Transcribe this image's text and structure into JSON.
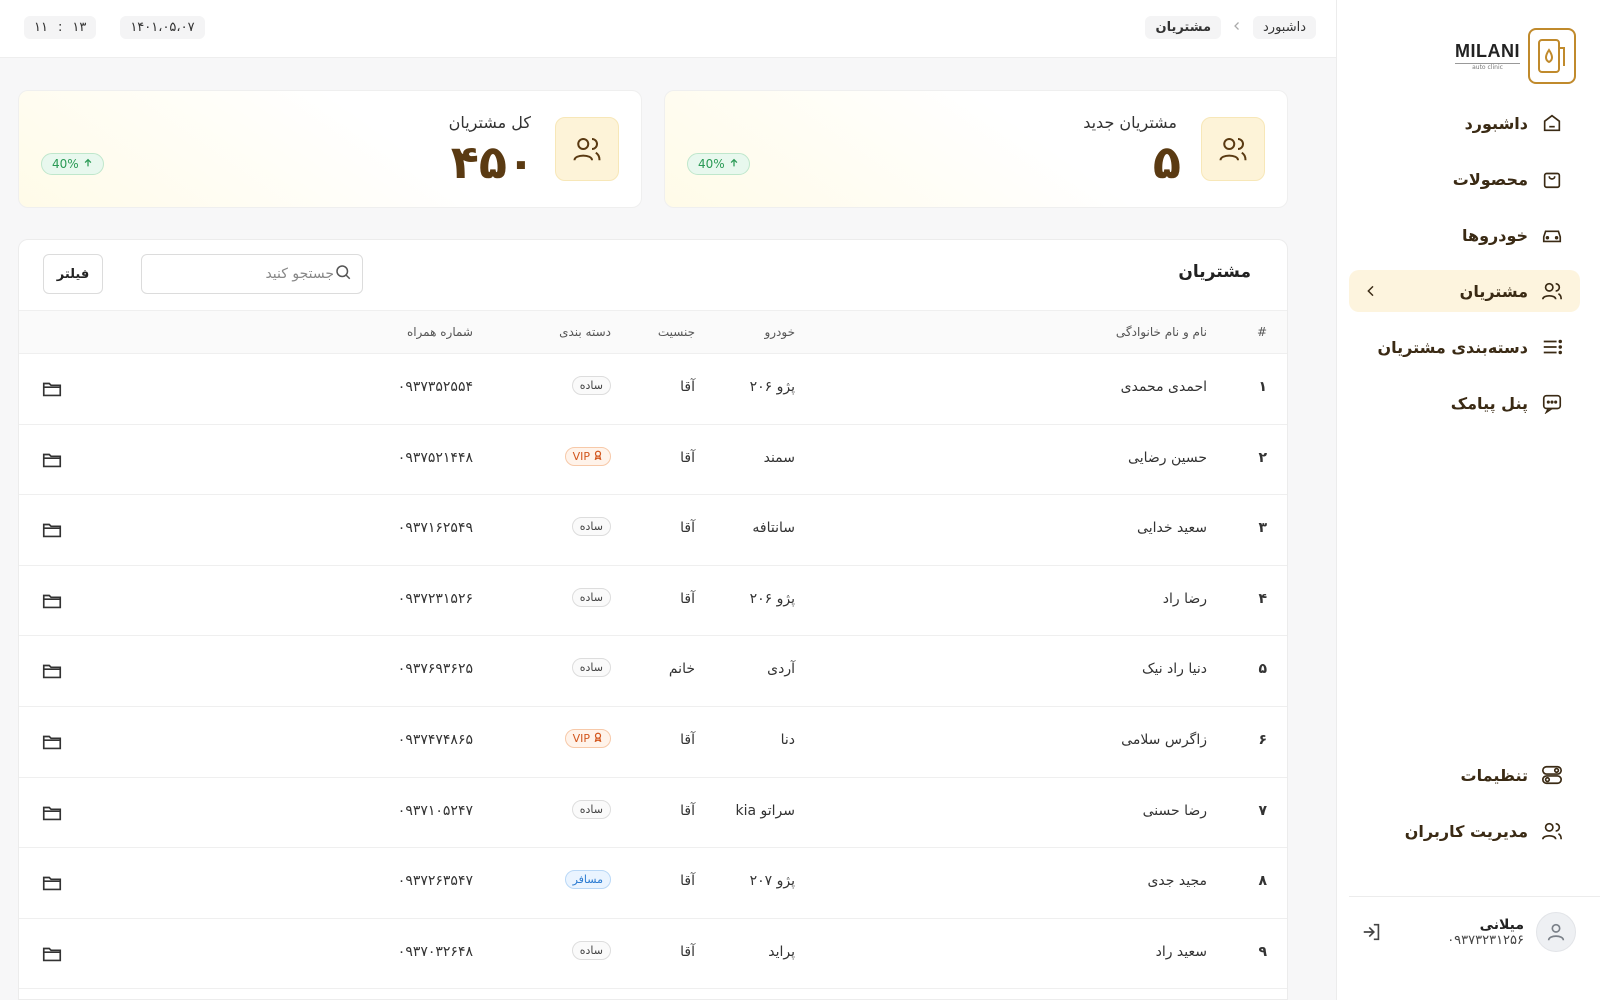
{
  "logo": {
    "name": "MILANI",
    "sub": "auto clinic"
  },
  "sidebar": {
    "items": [
      {
        "label": "داشبورد"
      },
      {
        "label": "محصولات"
      },
      {
        "label": "خودروها"
      },
      {
        "label": "مشتریان"
      },
      {
        "label": "دسته‌بندی مشتریان"
      },
      {
        "label": "پنل پیامک"
      }
    ],
    "bottom_items": [
      {
        "label": "تنظیمات"
      },
      {
        "label": "مدیریت کاربران"
      }
    ],
    "active_index": 3
  },
  "user": {
    "name": "میلانی",
    "phone": "۰۹۳۷۳۲۳۱۲۵۶"
  },
  "breadcrumb": {
    "root": "داشبورد",
    "current": "مشتریان"
  },
  "clock": {
    "date": "۱۴۰۱،۰۵،۰۷",
    "hour": "۱۳",
    "minute": "۱۱",
    "separator": ":"
  },
  "stats": {
    "new_customers": {
      "title": "مشتریان جدید",
      "value": "۵",
      "change": "40%"
    },
    "total_customers": {
      "title": "کل مشتریان",
      "value": "۴۵۰",
      "change": "40%"
    }
  },
  "table": {
    "title": "مشتریان",
    "search_placeholder": "جستجو کنید",
    "filter_label": "فیلتر",
    "columns": {
      "idx": "#",
      "name": "نام و نام خانوادگی",
      "car": "خودرو",
      "gender": "جنسیت",
      "category": "دسته بندی",
      "phone": "شماره همراه"
    },
    "rows": [
      {
        "idx": "۱",
        "name": "احمدی محمدی",
        "car": "پژو ۲۰۶",
        "gender": "آقا",
        "category": "ساده",
        "phone": "۰۹۳۷۳۵۲۵۵۴"
      },
      {
        "idx": "۲",
        "name": "حسین رضایی",
        "car": "سمند",
        "gender": "آقا",
        "category": "VIP",
        "phone": "۰۹۳۷۵۲۱۴۴۸"
      },
      {
        "idx": "۳",
        "name": "سعید خدایی",
        "car": "سانتافه",
        "gender": "آقا",
        "category": "ساده",
        "phone": "۰۹۳۷۱۶۲۵۴۹"
      },
      {
        "idx": "۴",
        "name": "رضا راد",
        "car": "پژو ۲۰۶",
        "gender": "آقا",
        "category": "ساده",
        "phone": "۰۹۳۷۲۳۱۵۲۶"
      },
      {
        "idx": "۵",
        "name": "دنیا راد نیک",
        "car": "آردی",
        "gender": "خانم",
        "category": "ساده",
        "phone": "۰۹۳۷۶۹۳۶۲۵"
      },
      {
        "idx": "۶",
        "name": "زاگرس سلامی",
        "car": "دنا",
        "gender": "آقا",
        "category": "VIP",
        "phone": "۰۹۳۷۴۷۴۸۶۵"
      },
      {
        "idx": "۷",
        "name": "رضا حسنی",
        "car": "سراتو kia",
        "gender": "آقا",
        "category": "ساده",
        "phone": "۰۹۳۷۱۰۵۲۴۷"
      },
      {
        "idx": "۸",
        "name": "مجید جدی",
        "car": "پژو ۲۰۷",
        "gender": "آقا",
        "category": "مسافر",
        "phone": "۰۹۳۷۲۶۳۵۴۷"
      },
      {
        "idx": "۹",
        "name": "سعید راد",
        "car": "پراید",
        "gender": "آقا",
        "category": "ساده",
        "phone": "۰۹۳۷۰۳۲۶۴۸"
      }
    ]
  },
  "colors": {
    "accent": "#c08a2c",
    "active_bg": "#fdf4de",
    "brand_dark": "#5a3a12",
    "positive": "#2a9a55"
  }
}
